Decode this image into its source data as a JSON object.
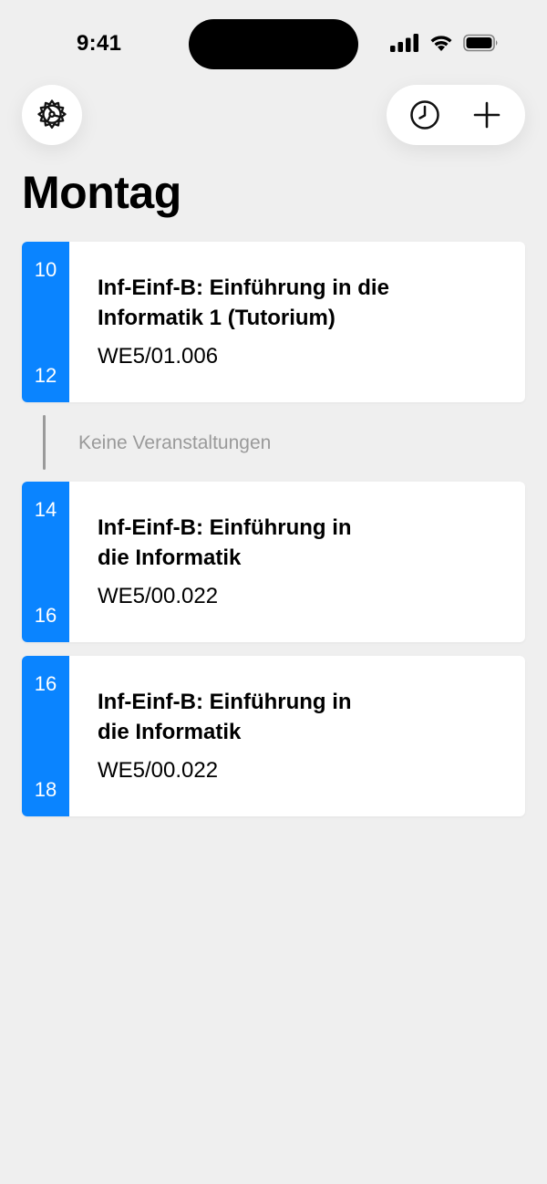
{
  "status_bar": {
    "time": "9:41",
    "icons": [
      "cellular-signal-icon",
      "wifi-icon",
      "battery-icon"
    ]
  },
  "toolbar": {
    "settings_icon": "gear-icon",
    "history_icon": "clock-icon",
    "add_icon": "plus-icon"
  },
  "day": {
    "title": "Montag"
  },
  "events": [
    {
      "start": "10",
      "end": "12",
      "title_line1": "Inf-Einf-B: Einführung in die",
      "title_line2": "Informatik 1 (Tutorium)",
      "room": "WE5/01.006"
    },
    {
      "start": "14",
      "end": "16",
      "title_line1": "Inf-Einf-B: Einführung in",
      "title_line2": "die Informatik",
      "room": "WE5/00.022"
    },
    {
      "start": "16",
      "end": "18",
      "title_line1": "Inf-Einf-B: Einführung in",
      "title_line2": "die Informatik",
      "room": "WE5/00.022"
    }
  ],
  "gap": {
    "label": "Keine Veranstaltungen"
  },
  "colors": {
    "accent": "#0a84ff",
    "background": "#efefef",
    "card": "#ffffff",
    "muted": "#9a9a9a"
  }
}
